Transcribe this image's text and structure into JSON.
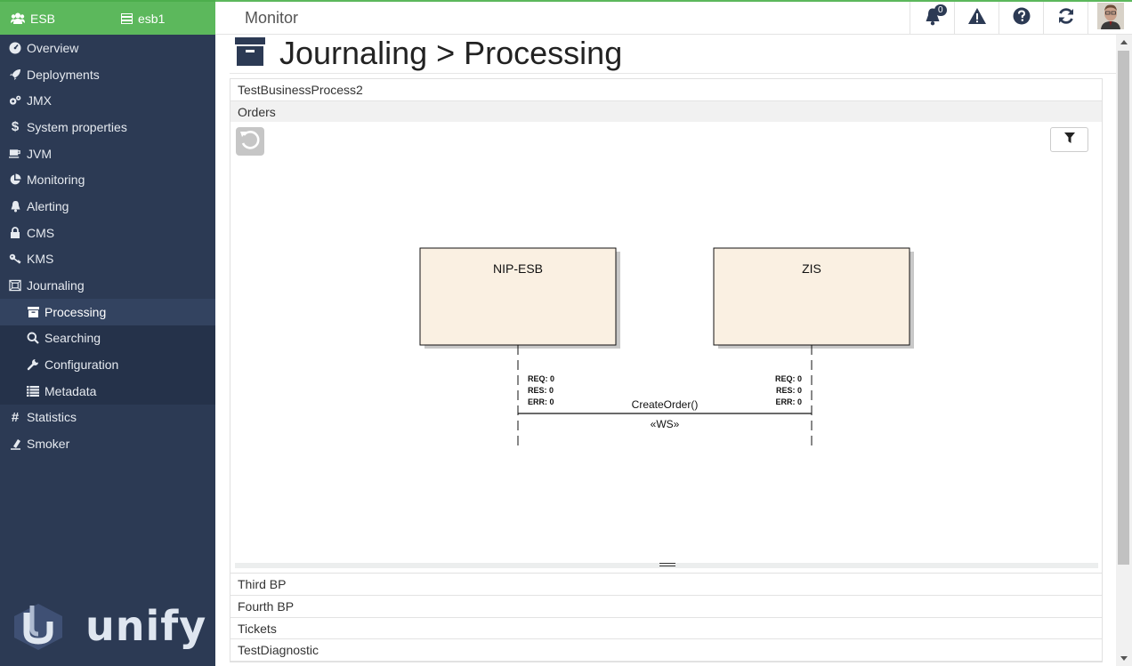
{
  "sidebar": {
    "app_name": "ESB",
    "instance": "esb1",
    "items": [
      {
        "label": "Overview"
      },
      {
        "label": "Deployments"
      },
      {
        "label": "JMX"
      },
      {
        "label": "System properties"
      },
      {
        "label": "JVM"
      },
      {
        "label": "Monitoring"
      },
      {
        "label": "Alerting"
      },
      {
        "label": "CMS"
      },
      {
        "label": "KMS"
      },
      {
        "label": "Journaling"
      }
    ],
    "sub_items": [
      {
        "label": "Processing"
      },
      {
        "label": "Searching"
      },
      {
        "label": "Configuration"
      },
      {
        "label": "Metadata"
      }
    ],
    "items_after": [
      {
        "label": "Statistics"
      },
      {
        "label": "Smoker"
      }
    ],
    "logo_text": "unify"
  },
  "topbar": {
    "title": "Monitor",
    "notification_count": "0"
  },
  "page": {
    "title": "Journaling > Processing"
  },
  "accordion": {
    "top": [
      "TestBusinessProcess2",
      "Orders"
    ],
    "bottom": [
      "Third BP",
      "Fourth BP",
      "Tickets",
      "TestDiagnostic"
    ]
  },
  "diagram": {
    "left_box": "NIP-ESB",
    "right_box": "ZIS",
    "left_stats": {
      "req": "REQ: 0",
      "res": "RES: 0",
      "err": "ERR: 0"
    },
    "right_stats": {
      "req": "REQ: 0",
      "res": "RES: 0",
      "err": "ERR: 0"
    },
    "message": "CreateOrder()",
    "stereotype": "«WS»"
  },
  "colors": {
    "sidebar": "#2c3a54",
    "accent_green": "#5cb85c",
    "box_fill": "#faf0e2"
  }
}
